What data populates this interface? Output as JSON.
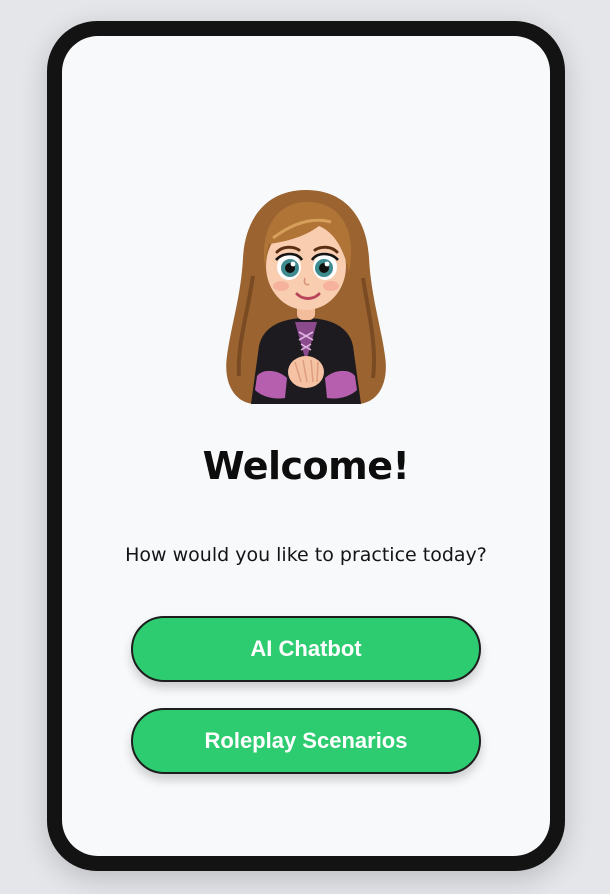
{
  "colors": {
    "screen_bg": "#f7f9fb",
    "frame": "#131313",
    "button_bg": "#2ecc71",
    "button_text": "#ffffff"
  },
  "avatar": {
    "icon": "cartoon-girl-avatar"
  },
  "welcome": {
    "title": "Welcome!",
    "prompt": "How would you like to practice today?"
  },
  "options": {
    "chatbot_label": "AI Chatbot",
    "roleplay_label": "Roleplay Scenarios"
  }
}
